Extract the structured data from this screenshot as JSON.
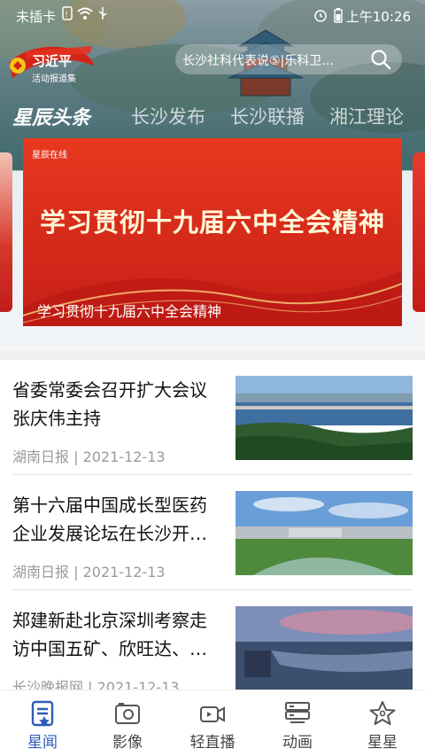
{
  "status_bar": {
    "carrier": "未插卡",
    "time": "上午10:26",
    "icons": [
      "sim-icon",
      "wifi-icon",
      "usb-icon",
      "alarm-icon",
      "battery-icon"
    ]
  },
  "header": {
    "badge_title": "习近平",
    "badge_subtitle": "活动报道集",
    "search_text": "长沙社科代表说⑤|乐科卫…"
  },
  "tabs": [
    {
      "label": "星辰头条",
      "active": true
    },
    {
      "label": "长沙发布",
      "active": false
    },
    {
      "label": "长沙联播",
      "active": false
    },
    {
      "label": "湘江理论",
      "active": false
    }
  ],
  "banner": {
    "brand": "星辰在线",
    "headline": "学习贯彻十九届六中全会精神",
    "caption": "学习贯彻十九届六中全会精神"
  },
  "news": [
    {
      "title": "省委常委会召开扩大会议张庆伟主持",
      "source": "湖南日报",
      "date": "2021-12-13"
    },
    {
      "title": "第十六届中国成长型医药企业发展论坛在长沙开…",
      "source": "湖南日报",
      "date": "2021-12-13"
    },
    {
      "title": "郑建新赴北京深圳考察走访中国五矿、欣旺达、…",
      "source": "长沙晚报网",
      "date": "2021-12-13"
    }
  ],
  "bottom_nav": [
    {
      "label": "星闻",
      "icon": "news-icon",
      "active": true
    },
    {
      "label": "影像",
      "icon": "camera-icon",
      "active": false
    },
    {
      "label": "轻直播",
      "icon": "video-icon",
      "active": false
    },
    {
      "label": "动画",
      "icon": "animation-icon",
      "active": false
    },
    {
      "label": "星星",
      "icon": "star-icon",
      "active": false
    }
  ],
  "colors": {
    "accent": "#2f5bb7",
    "banner_red": "#da2d1b",
    "meta_gray": "#9a9a9a"
  }
}
